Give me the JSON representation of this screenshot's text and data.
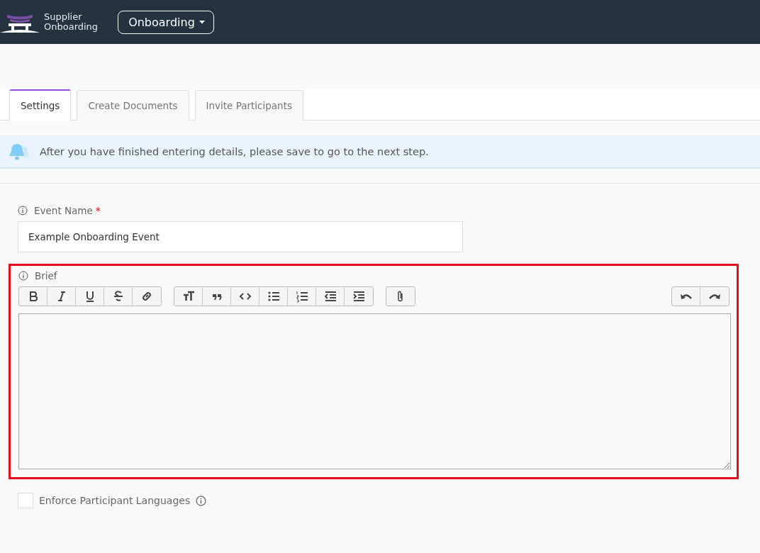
{
  "header": {
    "brand_line_1": "Supplier",
    "brand_line_2": "Onboarding",
    "menu": "Onboarding"
  },
  "tabs": [
    {
      "label": "Settings",
      "selected": true
    },
    {
      "label": "Create Documents",
      "selected": false
    },
    {
      "label": "Invite Participants",
      "selected": false
    }
  ],
  "alert": {
    "text": "After you have finished entering details, please save to go to the next step."
  },
  "event_name": {
    "label": "Event Name",
    "required_mark": "*",
    "value": "Example Onboarding Event"
  },
  "brief": {
    "label": "Brief",
    "highlighted": true,
    "toolbar_groups": [
      [
        {
          "kind": "bold"
        },
        {
          "kind": "italic"
        },
        {
          "kind": "underline"
        },
        {
          "kind": "strike"
        },
        {
          "kind": "link"
        }
      ],
      [
        {
          "kind": "heading"
        },
        {
          "kind": "quote"
        },
        {
          "kind": "code"
        },
        {
          "kind": "bullets"
        },
        {
          "kind": "numbers"
        },
        {
          "kind": "outdent"
        },
        {
          "kind": "indent"
        }
      ],
      [
        {
          "kind": "attach"
        }
      ],
      [
        {
          "kind": "undo"
        },
        {
          "kind": "redo"
        }
      ]
    ]
  },
  "enforce_languages": {
    "label": "Enforce Participant Languages",
    "checked": false
  }
}
